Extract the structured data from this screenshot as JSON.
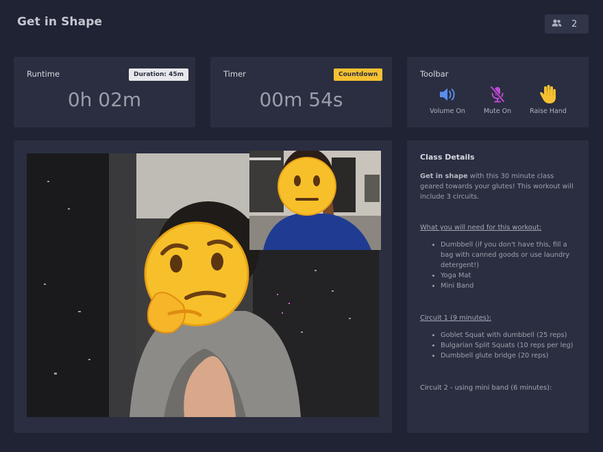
{
  "app": {
    "title": "Get in Shape"
  },
  "participants": {
    "count": "2",
    "icon": "people-icon"
  },
  "runtime": {
    "label": "Runtime",
    "badge": "Duration: 45m",
    "value": "0h 02m"
  },
  "timer": {
    "label": "Timer",
    "badge": "Countdown",
    "value": "00m 54s",
    "badge_color": "#f5c132"
  },
  "toolbar": {
    "label": "Toolbar",
    "volume_label": "Volume On",
    "mute_label": "Mute On",
    "raise_label": "Raise Hand",
    "volume_color": "#5b8def",
    "mute_color": "#c04ad4",
    "raise_color": "#f5c132"
  },
  "details": {
    "title": "Class Details",
    "intro_bold": "Get in shape",
    "intro_rest": " with this 30 minute class geared towards your glutes! This workout will include 3 circuits.",
    "need_heading": "What you will need for this workout:",
    "need_items": [
      "Dumbbell (if you don't have this, fill a bag with canned goods or use laundry detergent!)",
      "Yoga Mat",
      "Mini Band"
    ],
    "circuit1_heading": "Circuit 1 (9 minutes):",
    "circuit1_items": [
      "Goblet Squat with dumbbell (25 reps)",
      "Bulgarian Split Squats (10 reps per leg)",
      "Dumbbell glute bridge (20 reps)"
    ],
    "circuit2_heading": "Circuit 2 - using mini band (6 minutes):"
  }
}
